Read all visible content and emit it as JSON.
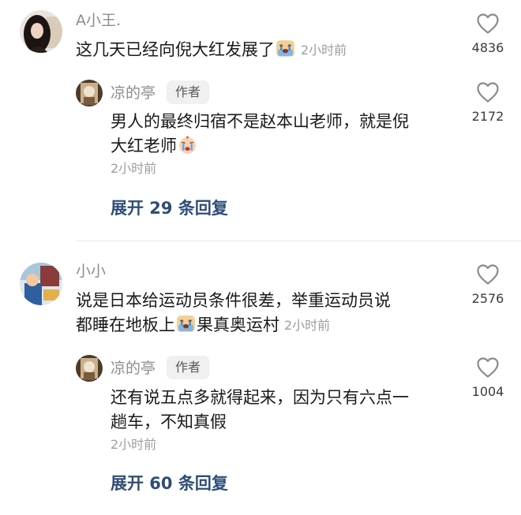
{
  "comments": [
    {
      "username": "A小王.",
      "text_before_emoji": "这几天已经向倪大红发展了",
      "emoji": "crying-face-emoji",
      "time": "2小时前",
      "likes": "4836",
      "reply": {
        "username": "凉的亭",
        "badge": "作者",
        "line1": "男人的最终归宿不是赵本山老师，就是倪",
        "line2": "大红老师",
        "emoji": "crying-face-emoji",
        "time": "2小时前",
        "likes": "2172"
      },
      "expand": "展开 29 条回复"
    },
    {
      "username": "小小",
      "line1": "说是日本给运动员条件很差，举重运动员说",
      "line2_before_emoji": "都睡在地板上",
      "emoji": "crying-face-emoji",
      "line2_after_emoji": "果真奥运村",
      "time": "2小时前",
      "likes": "2576",
      "reply": {
        "username": "凉的亭",
        "badge": "作者",
        "line1": "还有说五点多就得起来，因为只有六点一",
        "line2": "趟车，不知真假",
        "time": "2小时前",
        "likes": "1004"
      },
      "expand": "展开 60 条回复"
    }
  ],
  "colors": {
    "username": "#8c8c8c",
    "text": "#1a1a1a",
    "time": "#9e9e9e",
    "expand": "#2f4d77",
    "heart": "#8a8a8a"
  }
}
